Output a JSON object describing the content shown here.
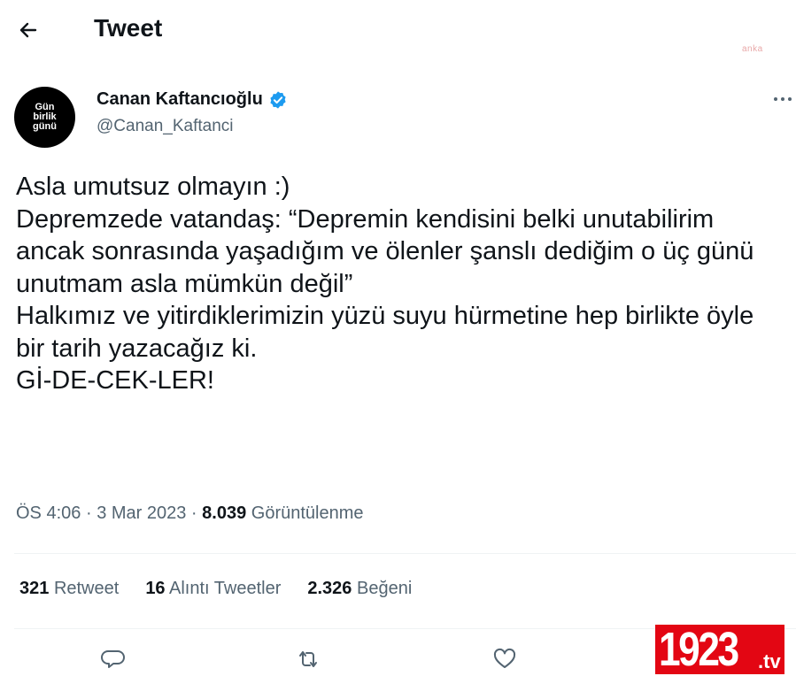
{
  "header": {
    "title": "Tweet",
    "back_icon": "arrow-left-icon"
  },
  "watermark_top": "anka",
  "author": {
    "avatar_lines": [
      "Gün",
      "birlik",
      "günü"
    ],
    "name": "Canan Kaftancıoğlu",
    "handle": "@Canan_Kaftanci",
    "verified_color": "#1d9bf0"
  },
  "tweet": {
    "text": "Asla umutsuz olmayın :)\nDepremzede vatandaş: “Depremin kendisini belki unutabilirim ancak sonrasında yaşadığım ve ölenler şanslı dediğim o üç günü unutmam asla mümkün değil”\nHalkımız ve yitirdiklerimizin yüzü suyu hürmetine hep birlikte öyle bir tarih yazacağız ki.\nGİ-DE-CEK-LER!"
  },
  "meta": {
    "time": "ÖS 4:06",
    "date": "3 Mar 2023",
    "views_count": "8.039",
    "views_label": "Görüntülenme",
    "sep": "·"
  },
  "stats": [
    {
      "count": "321",
      "label": "Retweet"
    },
    {
      "count": "16",
      "label": "Alıntı Tweetler"
    },
    {
      "count": "2.326",
      "label": "Beğeni"
    }
  ],
  "actions": [
    "reply-icon",
    "retweet-icon",
    "like-icon"
  ],
  "logo": {
    "number": "1923",
    "suffix": ".tv",
    "color": "#e30613"
  }
}
